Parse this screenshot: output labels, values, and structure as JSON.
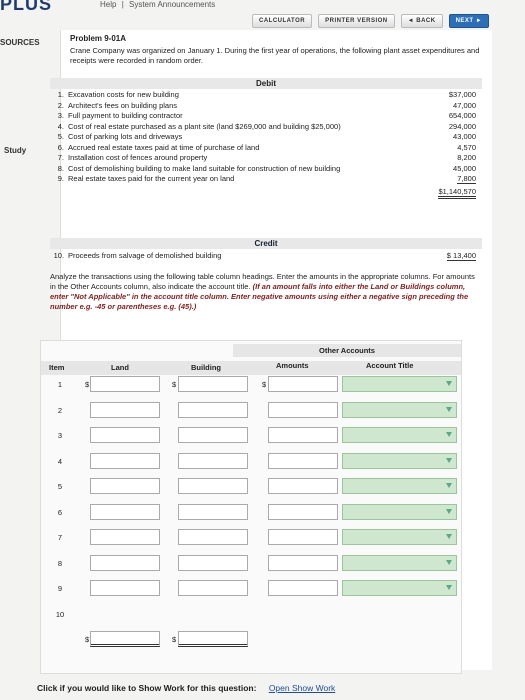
{
  "header": {
    "logo_text": "PLUS",
    "help": "Help",
    "separator": "|",
    "announcements": "System Announcements",
    "buttons": {
      "calculator": "CALCULATOR",
      "printer": "PRINTER VERSION",
      "back": "◄ BACK",
      "next": "NEXT ►"
    }
  },
  "sidebar": {
    "resources": "SOURCES",
    "study": "Study"
  },
  "problem": {
    "title": "Problem 9-01A",
    "description": "Crane Company was organized on January 1. During the first year of operations, the following plant asset expenditures and receipts were recorded in random order."
  },
  "debit": {
    "header": "Debit",
    "items": [
      {
        "n": "1.",
        "text": "Excavation costs for new building",
        "amount": "$37,000"
      },
      {
        "n": "2.",
        "text": "Architect's fees on building plans",
        "amount": "47,000"
      },
      {
        "n": "3.",
        "text": "Full payment to building contractor",
        "amount": "654,000"
      },
      {
        "n": "4.",
        "text": "Cost of real estate purchased as a plant site (land $269,000 and building $25,000)",
        "amount": "294,000"
      },
      {
        "n": "5.",
        "text": "Cost of parking lots and driveways",
        "amount": "43,000"
      },
      {
        "n": "6.",
        "text": "Accrued real estate taxes paid at time of purchase of land",
        "amount": "4,570"
      },
      {
        "n": "7.",
        "text": "Installation cost of fences around property",
        "amount": "8,200"
      },
      {
        "n": "8.",
        "text": "Cost of demolishing building to make land suitable for construction of new building",
        "amount": "45,000"
      },
      {
        "n": "9.",
        "text": "Real estate taxes paid for the current year on land",
        "amount": "7,800"
      }
    ],
    "total": "$1,140,570"
  },
  "credit": {
    "header": "Credit",
    "item": {
      "n": "10.",
      "text": "Proceeds from salvage of demolished building",
      "amount": "$ 13,400"
    }
  },
  "instructions": {
    "plain": "Analyze the transactions using the following table column headings. Enter the amounts in the appropriate columns. For amounts in the Other Accounts column, also indicate the account title.",
    "emph": "(If an amount falls into either the Land or Buildings column, enter \"Not Applicable\" in the account title column. Enter negative amounts using either a negative sign preceding the number e.g. -45 or parentheses e.g. (45).)"
  },
  "table": {
    "headers": {
      "item": "Item",
      "land": "Land",
      "building": "Building",
      "other": "Other Accounts",
      "amounts": "Amounts",
      "account_title": "Account Title"
    },
    "dollar": "$",
    "rows": [
      "1",
      "2",
      "3",
      "4",
      "5",
      "6",
      "7",
      "8",
      "9",
      "10"
    ]
  },
  "footer": {
    "prompt": "Click if you would like to Show Work for this question:",
    "link": "Open Show Work"
  }
}
